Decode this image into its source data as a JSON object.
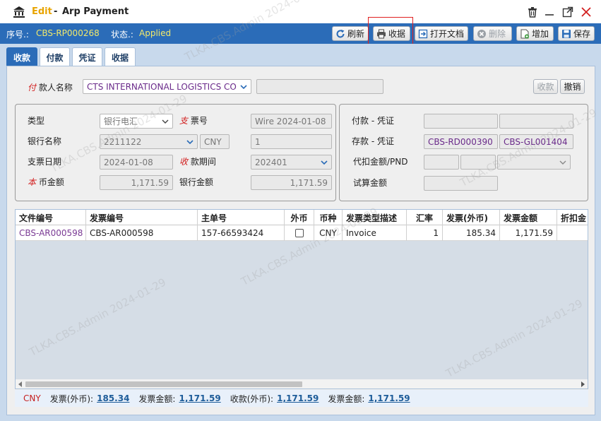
{
  "window": {
    "title_prefix": "Edit",
    "title_separator": "-",
    "title_name": "Arp Payment"
  },
  "info": {
    "serial_label": "序号.:",
    "serial_value": "CBS-RP000268",
    "status_label": "状态.:",
    "status_value": "Applied"
  },
  "toolbar": {
    "refresh": "刷新",
    "print_receipt": "收据",
    "open_doc": "打开文档",
    "delete": "删除",
    "add": "增加",
    "save": "保存"
  },
  "tabs": [
    "收款",
    "付款",
    "凭证",
    "收据"
  ],
  "payer": {
    "label_mark": "付",
    "label_rest": "款人名称",
    "value": "CTS INTERNATIONAL LOGISTICS CO",
    "extra_value": "",
    "receive_button": "收款",
    "cancel_button": "撤销"
  },
  "form": {
    "type_label": "类型",
    "type_value": "银行电汇",
    "ticket_mark": "支",
    "ticket_rest": "票号",
    "ticket_value": "Wire 2024-01-08",
    "bank_label": "银行名称",
    "bank_value": "2211122",
    "currency_value": "CNY",
    "rate_value": "1",
    "check_date_label": "支票日期",
    "check_date_value": "2024-01-08",
    "period_mark": "收",
    "period_rest": "款期间",
    "period_value": "202401",
    "local_mark": "本",
    "local_rest": "币金额",
    "local_value": "1,171.59",
    "bank_amount_label": "银行金额",
    "bank_amount_value": "1,171.59"
  },
  "voucher": {
    "pay_label": "付款 - 凭证",
    "pay_value_1": "",
    "pay_value_2": "",
    "deposit_label": "存款 - 凭证",
    "deposit_value_1": "CBS-RD000390",
    "deposit_value_2": "CBS-GL001404",
    "withhold_label": "代扣金额/PND",
    "trial_label": "试算金额"
  },
  "grid": {
    "columns": [
      "文件编号",
      "发票编号",
      "主单号",
      "外币",
      "币种",
      "发票类型描述",
      "汇率",
      "发票(外币)",
      "发票金额",
      "折扣金"
    ],
    "rows": [
      {
        "doc_no": "CBS-AR000598",
        "invoice_no": "CBS-AR000598",
        "master_no": "157-66593424",
        "foreign": false,
        "currency": "CNY",
        "invoice_type": "Invoice",
        "rate": "1",
        "invoice_foreign": "185.34",
        "invoice_amount": "1,171.59",
        "discount": ""
      }
    ]
  },
  "footer": {
    "currency": "CNY",
    "inv_foreign_label": "发票(外币):",
    "inv_foreign_value": "185.34",
    "inv_amount_label": "发票金额:",
    "inv_amount_value": "1,171.59",
    "recv_foreign_label": "收款(外币):",
    "recv_foreign_value": "1,171.59",
    "inv_amount2_label": "发票金额:",
    "inv_amount2_value": "1,171.59"
  },
  "watermark": "TLKA.CBS.Admin 2024-01-29",
  "colors": {
    "accent_blue": "#2b6cb8",
    "edit_orange": "#e8a400",
    "status_yellow": "#f2e96b",
    "link_purple": "#7a3a94",
    "required_red": "#d21e1e"
  }
}
